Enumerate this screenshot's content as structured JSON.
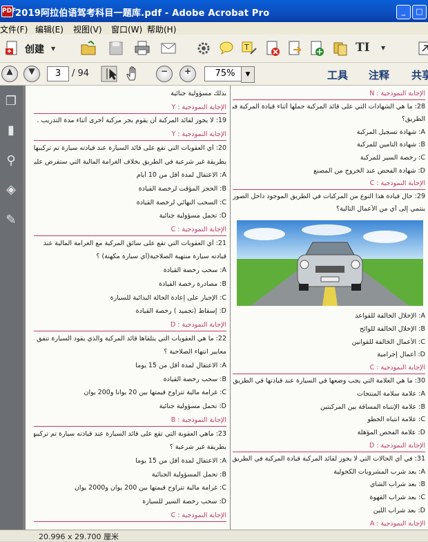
{
  "window": {
    "title": "2019阿拉伯语驾考科目一题库.pdf - Adobe Acrobat Pro",
    "app_icon_label": "PDF"
  },
  "menu": [
    "文件(F)",
    "编辑(E)",
    "视图(V)",
    "窗口(W)",
    "帮助(H)"
  ],
  "toolbar": {
    "create_label": "创建",
    "text_tool_label": "TI"
  },
  "nav": {
    "current_page": "3",
    "total_pages": "/ 94",
    "zoom": "75%"
  },
  "panes": {
    "tools": "工具",
    "comment": "注释",
    "share": "共享"
  },
  "status": {
    "page_size": "20.996 x 29.700 厘米"
  },
  "document": {
    "left": [
      "بذلك مسؤولية جنائية",
      "الإجابة النموذجية :   Y",
      "19: لا يجوز لقائد المركبة أن يقوم بجر مركبة أخرى أثناء مدة التدريب .",
      "الإجابة النموذجية :   Y",
      "20: أي العقوبات التي تقع على قائد السيارة عند قيادته سيارة تم تركيبها",
      "بطريقة غير شرعية في الطريق بخلاف الغرامة المالية التي ستفرض عليه ؟",
      "A: الاعتقال لمدة أقل من 10 أيام",
      "B: الحجز المؤقت لرخصة القيادة",
      "C: السحب النهائي لرخصة القيادة",
      "D: تحمل مسؤولية جنائية",
      "الإجابة النموذجية :   C",
      "21: أي العقوبات التي تقع على سائق المركبة مع الغرامة المالية عند",
      "قيادته سيارة منتهية الصلاحية(أي سيارة مكهنة) ؟",
      "A: سحب رخصة القيادة",
      "B: مصادرة رخصة القيادة",
      "C: الإجبار على إعادة الحالة البدائية للسيارة",
      "D: إسقاط (تجميد ) رخصة القيادة",
      "الإجابة النموذجية :   D",
      "22: ما هي العقوبات التي يتلقاها قائد المركبة والذي يقود السيارة تتفق مع",
      "معايير انتهاء الصلاحية ؟",
      "A: الاعتقال لمدة أقل من 15 يوما",
      "B: سحب رخصة القيادة",
      "C: غرامة مالية تتراوح قيمتها بين 20 يوانا و200 يوان",
      "D: تحمل مسؤولية جنائية",
      "الإجابة النموذجية :   B",
      "23: ماهي العقوبة التي تقع على قائد السيارة عند قيادته سيارة تم تركيبها",
      "بطريقة غير شرعية ؟",
      "A: الاعتقال لمدة أقل من 15 يوما",
      "B: تحمل المسؤولية الجنائية",
      "C: غرامة مالية تتراوح قيمتها بين 200 يوان و2000 يوان",
      "D: سحب رخصة السير للسيارة",
      "الإجابة النموذجية :   C"
    ],
    "right_top": [
      "الإجابة النموذجية :   N",
      "28: ما هي الشهادات التي على قائد المركبة حملها أثناء قيادة المركبة في",
      "الطريق؟",
      "A: شهادة تسجيل المركبة",
      "B: شهادة التأمين للمركبة",
      "C: رخصة السير للمركبة",
      "D: شهادة الفحص عند الخروج من المصنع",
      "الإجابة النموذجية :   C",
      "29: حال قيادة هذا النوع من المركبات في الطريق الموجود داخل الصورة",
      "ينتمي إلى أي من الأعمال التالية؟"
    ],
    "right_bottom": [
      "A: الإخلال الخالفة للقواعد",
      "B: الإخلال الخالفة للوائح",
      "C: الأعمال الخالفة للقوانين",
      "D: أعمال إجرامية",
      "الإجابة النموذجية :   C",
      "30: ما هي العلامة التي يجب وضعها في السيارة عند قيادتها في الطريق؟",
      "A:   علامة سلامة المنتجات",
      "B: علامة الإنتباه المسافة بين المركبتين",
      "C: علامة انتباه الخطو",
      "D: علامة الفحص المؤهلة",
      "الإجابة النموذجية :   D",
      "31: في أي الحالات التي لا يجوز لقائد المركبة قيادة المركبة في الطريق؟",
      "A: بعد شرب المشروبات الكحولية",
      "B: بعد شراب الشاي",
      "C: بعد شراب القهوة",
      "D: بعد شراب اللبن",
      "الإجابة النموذجية :   A"
    ]
  },
  "colors": {
    "titlebar": "#0c4fc0",
    "answer": "#c23a6a",
    "pane_label": "#1e3f73",
    "nav_bg": "#6b6f74"
  }
}
